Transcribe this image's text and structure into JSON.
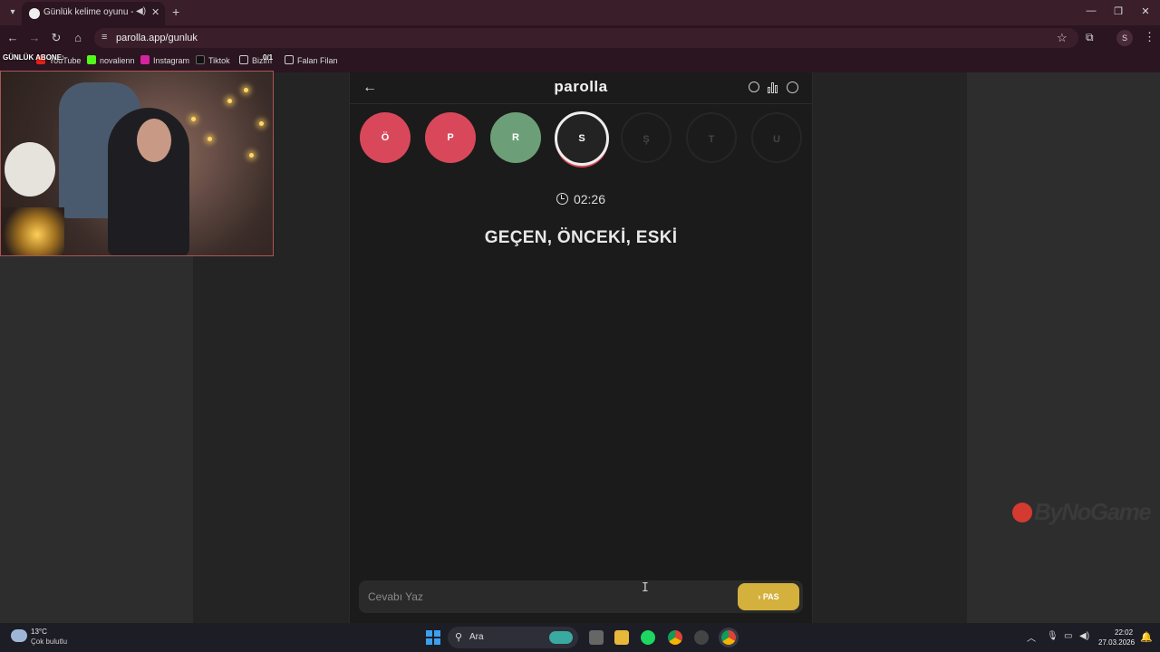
{
  "browser": {
    "tab_title": "Günlük kelime oyunu - parolla",
    "tab_sound_icon": "speaker-icon",
    "url": "parolla.app/gunluk",
    "profile_initial": "S",
    "bookmarks": [
      {
        "label": "YouTube",
        "icon": "youtube-icon",
        "color": "#e62117"
      },
      {
        "label": "novalienn",
        "icon": "kick-icon",
        "color": "#53fc18"
      },
      {
        "label": "Instagram",
        "icon": "instagram-icon",
        "color": "#d6249f"
      },
      {
        "label": "Tiktok",
        "icon": "tiktok-icon",
        "color": "#111111"
      },
      {
        "label": "Bizim",
        "icon": "folder-icon",
        "color": "#cccccc"
      },
      {
        "label": "Falan Filan",
        "icon": "folder-icon",
        "color": "#cccccc"
      }
    ]
  },
  "overlay": {
    "label": "GÜNLÜK ABONE:",
    "counter": "0/1"
  },
  "game": {
    "title": "parolla",
    "letters": [
      {
        "letter": "Ö",
        "state": "wrong"
      },
      {
        "letter": "P",
        "state": "wrong"
      },
      {
        "letter": "R",
        "state": "correct"
      },
      {
        "letter": "S",
        "state": "active"
      },
      {
        "letter": "Ş",
        "state": "pending"
      },
      {
        "letter": "T",
        "state": "pending"
      },
      {
        "letter": "U",
        "state": "pending"
      }
    ],
    "timer": "02:26",
    "clue": "GEÇEN, ÖNCEKİ, ESKİ",
    "answer_placeholder": "Cevabı Yaz",
    "pass_label": "PAS",
    "colors": {
      "wrong": "#d9485a",
      "correct": "#6c9f77",
      "pass": "#d4b03c"
    }
  },
  "watermark": "ByNoGame",
  "taskbar": {
    "weather_temp": "13°C",
    "weather_desc": "Çok bulutlu",
    "search_label": "Ara",
    "time": "22:02",
    "date": "27.03.2026"
  }
}
